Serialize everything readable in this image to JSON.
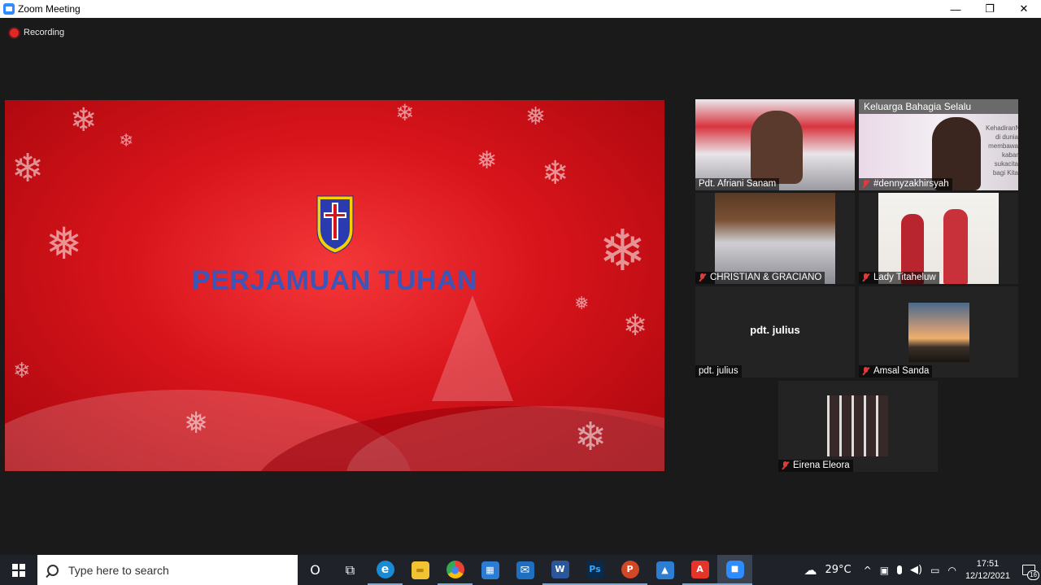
{
  "window": {
    "title": "Zoom Meeting",
    "minimize": "—",
    "restore": "❐",
    "close": "✕"
  },
  "meeting": {
    "recording_label": "Recording",
    "share": {
      "slide_title": "PERJAMUAN TUHAN"
    },
    "participants": [
      {
        "name": "Pdt. Afriani Sanam",
        "muted": false,
        "active_speaker": true
      },
      {
        "name": "#dennyzakhirsyah",
        "muted": true,
        "overlay_text": "Keluarga Bahagia Selalu",
        "side_text": "KehadiranNya di dunia membawa kabar sukacita bagi Kita"
      },
      {
        "name": "CHRISTIAN & GRACIANO",
        "muted": true
      },
      {
        "name": "Lady Titaheluw",
        "muted": true
      },
      {
        "name": "pdt. julius",
        "muted": false,
        "display_name": "pdt. julius"
      },
      {
        "name": "Amsal Sanda",
        "muted": true
      },
      {
        "name": "Eirena Eleora",
        "muted": true
      }
    ]
  },
  "taskbar": {
    "search_placeholder": "Type here to search",
    "apps": [
      {
        "icon": "cortana-icon",
        "label": "O"
      },
      {
        "icon": "task-view-icon",
        "label": "⧉"
      },
      {
        "icon": "edge-icon",
        "label": "e",
        "color": "#1a8ad4"
      },
      {
        "icon": "file-explorer-icon",
        "label": "▬",
        "color": "#f1c232"
      },
      {
        "icon": "chrome-icon",
        "label": "●",
        "color": "#34a853"
      },
      {
        "icon": "store-icon",
        "label": "▦",
        "color": "#2b7cd3"
      },
      {
        "icon": "mail-icon",
        "label": "✉",
        "color": "#1f6fc1"
      },
      {
        "icon": "word-icon",
        "label": "W",
        "color": "#2b579a"
      },
      {
        "icon": "photoshop-icon",
        "label": "Ps",
        "color": "#0b2a4a"
      },
      {
        "icon": "powerpoint-icon",
        "label": "P",
        "color": "#d24726"
      },
      {
        "icon": "photos-icon",
        "label": "▲",
        "color": "#2d7dd2"
      },
      {
        "icon": "acrobat-icon",
        "label": "A",
        "color": "#e5352b"
      },
      {
        "icon": "zoom-icon",
        "label": "■",
        "color": "#2d8cff"
      }
    ],
    "tray": {
      "weather_icon": "cloud-rain-icon",
      "temperature": "29°C",
      "chevron": "^",
      "meet_now": "▣",
      "mic": "🎤",
      "volume": "🔊",
      "battery": "▭",
      "wifi": "◠",
      "time": "17:51",
      "date": "12/12/2021",
      "notification_count": "16"
    }
  }
}
